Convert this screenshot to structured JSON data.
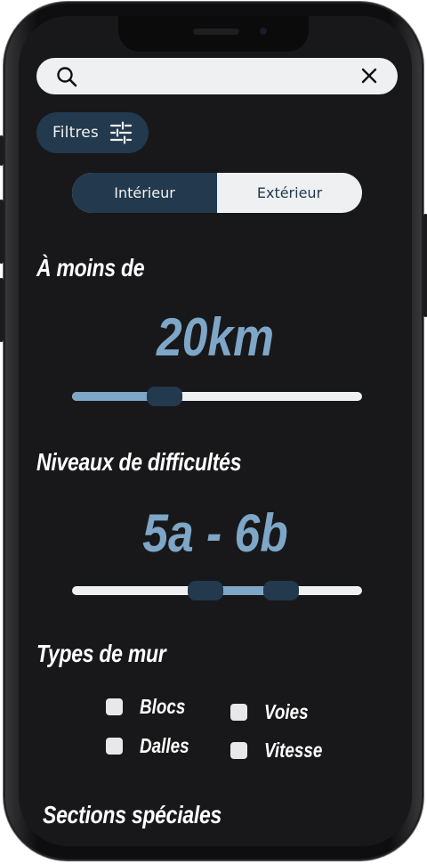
{
  "search": {
    "query": "",
    "placeholder": ""
  },
  "filters": {
    "label": "Filtres",
    "icon": "sliders-icon"
  },
  "location_toggle": {
    "options": [
      "Intérieur",
      "Extérieur"
    ],
    "selected": "Intérieur"
  },
  "distance": {
    "heading": "À moins de",
    "value_label": "20km",
    "value": 20,
    "slider_fraction": 0.32
  },
  "difficulty": {
    "heading": "Niveaux de difficultés",
    "range_label": "5a  -  6b",
    "low_fraction": 0.46,
    "high_fraction": 0.72
  },
  "wall_types": {
    "heading": "Types de mur",
    "options": [
      {
        "label": "Blocs",
        "checked": false
      },
      {
        "label": "Voies",
        "checked": false
      },
      {
        "label": "Dalles",
        "checked": false
      },
      {
        "label": "Vitesse",
        "checked": false
      }
    ]
  },
  "special_sections": {
    "heading": "Sections spéciales"
  },
  "colors": {
    "accent_dark": "#22394e",
    "accent_light": "#7ea6c7",
    "screen_background": "#18181a",
    "control_background": "#eff0f2"
  }
}
